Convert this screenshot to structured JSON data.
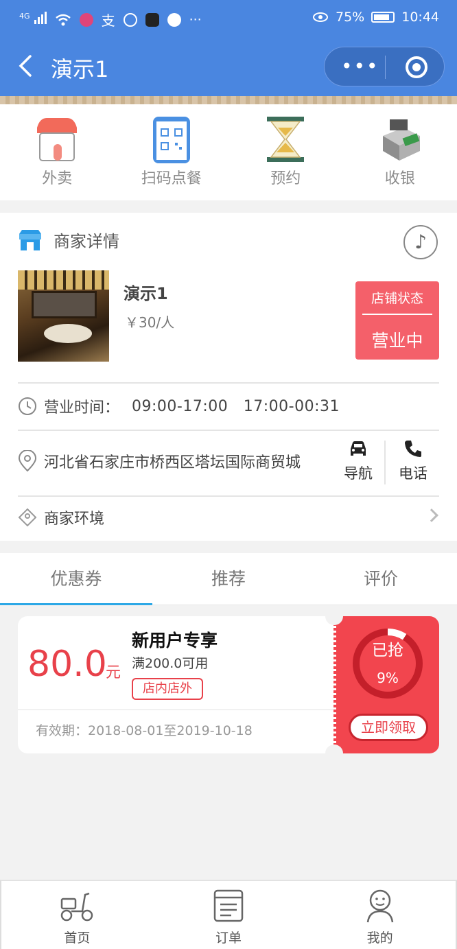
{
  "status_bar": {
    "network": "4G",
    "battery": "75%",
    "time": "10:44",
    "more": "···"
  },
  "header": {
    "title": "演示1",
    "more_label": "•••"
  },
  "quick_nav": [
    {
      "label": "外卖",
      "icon": "shop-awning-icon"
    },
    {
      "label": "扫码点餐",
      "icon": "qr-phone-icon"
    },
    {
      "label": "预约",
      "icon": "hourglass-icon"
    },
    {
      "label": "收银",
      "icon": "cash-machine-icon"
    }
  ],
  "merchant": {
    "section_title": "商家详情",
    "name": "演示1",
    "price": "￥30/人",
    "status_label": "店铺状态",
    "status_value": "营业中",
    "hours_label": "营业时间：",
    "hours_values": "09:00-17:00   17:00-00:31",
    "address": "河北省石家庄市桥西区塔坛国际商贸城",
    "navigate_label": "导航",
    "call_label": "电话",
    "environment_label": "商家环境"
  },
  "tabs": [
    "优惠券",
    "推荐",
    "评价"
  ],
  "coupon": {
    "amount": "80.0",
    "unit": "元",
    "title": "新用户专享",
    "condition": "满200.0可用",
    "tag": "店内店外",
    "validity": "有效期：2018-08-01至2019-10-18",
    "grabbed_label": "已抢",
    "grabbed_percent": "9%",
    "grabbed_fraction": 0.09,
    "claim_label": "立即领取"
  },
  "bottom_nav": [
    {
      "label": "首页",
      "icon": "scooter-icon"
    },
    {
      "label": "订单",
      "icon": "order-list-icon"
    },
    {
      "label": "我的",
      "icon": "user-icon"
    }
  ],
  "colors": {
    "header": "#4a86e0",
    "accent_red": "#f2454e",
    "status_pink": "#f4606a",
    "tab_active": "#2da8e6"
  }
}
